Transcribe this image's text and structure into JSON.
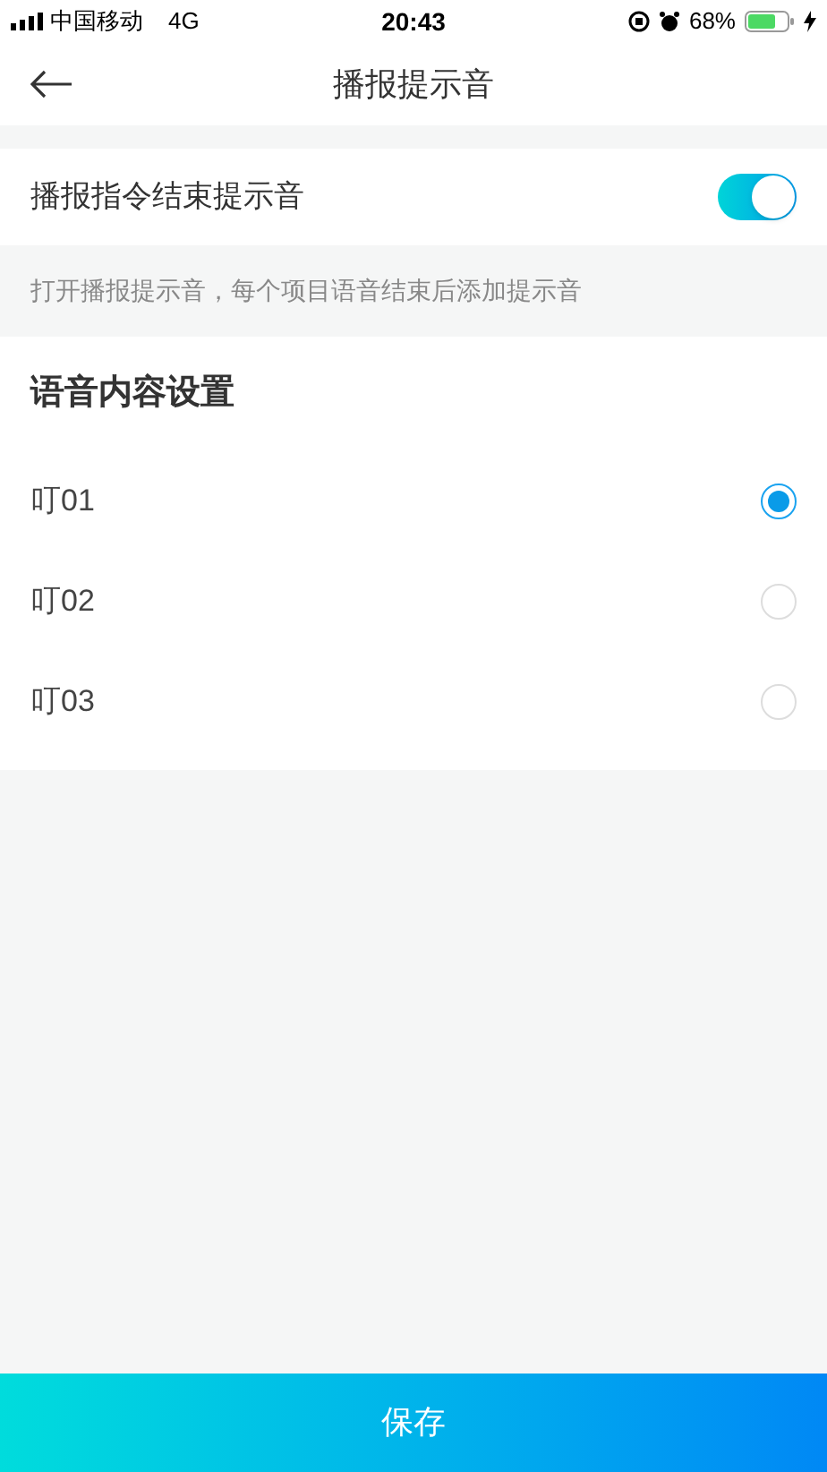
{
  "status_bar": {
    "carrier": "中国移动",
    "network": "4G",
    "time": "20:43",
    "battery": "68%"
  },
  "nav": {
    "title": "播报提示音"
  },
  "toggle": {
    "label": "播报指令结束提示音",
    "on": true,
    "hint": "打开播报提示音，每个项目语音结束后添加提示音"
  },
  "section": {
    "title": "语音内容设置",
    "options": [
      {
        "label": "叮01",
        "selected": true
      },
      {
        "label": "叮02",
        "selected": false
      },
      {
        "label": "叮03",
        "selected": false
      }
    ]
  },
  "save_button": "保存"
}
